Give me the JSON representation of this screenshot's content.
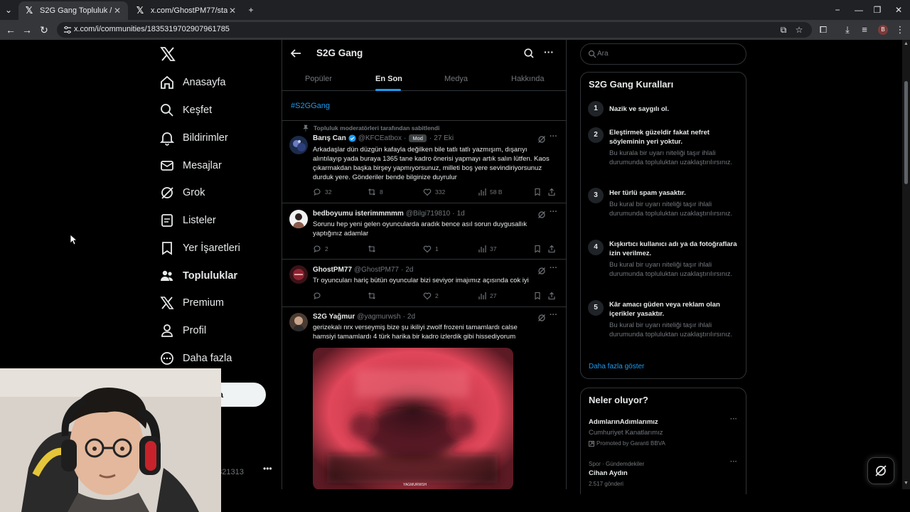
{
  "browser": {
    "tabs": [
      {
        "title": "S2G Gang Topluluk / X",
        "active": true
      },
      {
        "title": "x.com/GhostPM77/status/1983...",
        "active": false
      }
    ],
    "url": "x.com/i/communities/1835319702907961785",
    "profile_initial": "B"
  },
  "nav": {
    "items": [
      {
        "label": "Anasayfa",
        "icon": "home-icon"
      },
      {
        "label": "Keşfet",
        "icon": "search-icon"
      },
      {
        "label": "Bildirimler",
        "icon": "bell-icon"
      },
      {
        "label": "Mesajlar",
        "icon": "mail-icon"
      },
      {
        "label": "Grok",
        "icon": "grok-icon"
      },
      {
        "label": "Listeler",
        "icon": "list-icon"
      },
      {
        "label": "Yer İşaretleri",
        "icon": "bookmark-icon"
      },
      {
        "label": "Topluluklar",
        "icon": "communities-icon"
      },
      {
        "label": "Premium",
        "icon": "x-logo-icon"
      },
      {
        "label": "Profil",
        "icon": "person-icon"
      },
      {
        "label": "Daha fazla",
        "icon": "more-circle-icon"
      }
    ],
    "post_button": "ayınla",
    "account_handle": "2321313"
  },
  "community": {
    "title": "S2G Gang",
    "tabs": [
      "Popüler",
      "En Son",
      "Medya",
      "Hakkında"
    ],
    "active_tab": "En Son",
    "hashtag": "#S2GGang"
  },
  "posts": [
    {
      "pinned_label": "Topluluk moderatörleri tarafından sabitlendi",
      "name": "Barış Can",
      "verified": true,
      "handle": "@KFCEatbox",
      "badge": "Mod",
      "time": "27 Eki",
      "text": "Arkadaşlar dün düzgün kafayla değilken bile tatlı tatlı yazmışım, dışarıyı alıntılayıp yada buraya 1365 tane kadro önerisi yapmayı artık salın lütfen. Kaos çıkarmakdan başka birşey yapmıyorsunuz, milleti boş yere sevindiriyorsunuz durduk yere. Gönderiler bende bilginize duyrulur",
      "replies": "32",
      "reposts": "8",
      "likes": "332",
      "views": "58 B"
    },
    {
      "name": "bedboyumu isterimmmmm",
      "handle": "@Bilgi719810",
      "time": "1d",
      "text": "Sorunu hep yeni gelen oyuncularda aradık bence asıl sorun duygusallık yaptığınız adamlar",
      "replies": "2",
      "reposts": "",
      "likes": "1",
      "views": "37"
    },
    {
      "name": "GhostPM77",
      "handle": "@GhostPM77",
      "time": "2d",
      "text": "Tr oyuncuları hariç bütün oyuncular bizi seviyor imajımız açısında cok iyi",
      "replies": "",
      "reposts": "",
      "likes": "2",
      "views": "27"
    },
    {
      "name": "S2G Yağmur",
      "handle": "@yagmurwsh",
      "time": "2d",
      "text": "gerizekalı nrx verseymiş bize şu ikiliyi zwolf frozeni tamamlardı calse hamsiyi tamamlardı 4 türk harika bir kadro izlerdik gibi hissediyorum",
      "media_caption": "YAGMURWSH"
    }
  ],
  "sidebar": {
    "search_placeholder": "Ara",
    "rules_title": "S2G Gang Kuralları",
    "rules": [
      {
        "num": "1",
        "title": "Nazik ve saygılı ol.",
        "desc": ""
      },
      {
        "num": "2",
        "title": "Eleştirmek güzeldir fakat nefret söyleminin yeri yoktur.",
        "desc": "Bu kurala bir uyarı niteliği taşır ihlali durumunda topluluktan uzaklaştırılırsınız."
      },
      {
        "num": "3",
        "title": "Her türlü spam yasaktır.",
        "desc": "Bu kural bir uyarı niteliği taşır ihlali durumunda topluluktan uzaklaştırılırsınız."
      },
      {
        "num": "4",
        "title": "Kışkırtıcı kullanıcı adı ya da fotoğraflara izin verilmez.",
        "desc": "Bu kural bir uyarı niteliği taşır ihlali durumunda topluluktan uzaklaştırılırsınız."
      },
      {
        "num": "5",
        "title": "Kâr amacı güden veya reklam olan içerikler yasaktır.",
        "desc": "Bu kural bir uyarı niteliği taşır ihlali durumunda topluluktan uzaklaştırılırsınız."
      }
    ],
    "show_more": "Daha fazla göster",
    "trends_title": "Neler oluyor?",
    "trends": [
      {
        "title": "AdımlarınAdımlarımız",
        "sub": "Cumhuriyet Kanatlarımız",
        "small": "Promoted by Garanti BBVA"
      },
      {
        "context": "Spor · Gündemdekiler",
        "title": "Cihan Aydın",
        "small": "2.517 gönderi"
      }
    ]
  },
  "colors": {
    "accent": "#1d9bf0",
    "background": "#000000",
    "muted": "#71767b",
    "border": "#2f3336"
  }
}
